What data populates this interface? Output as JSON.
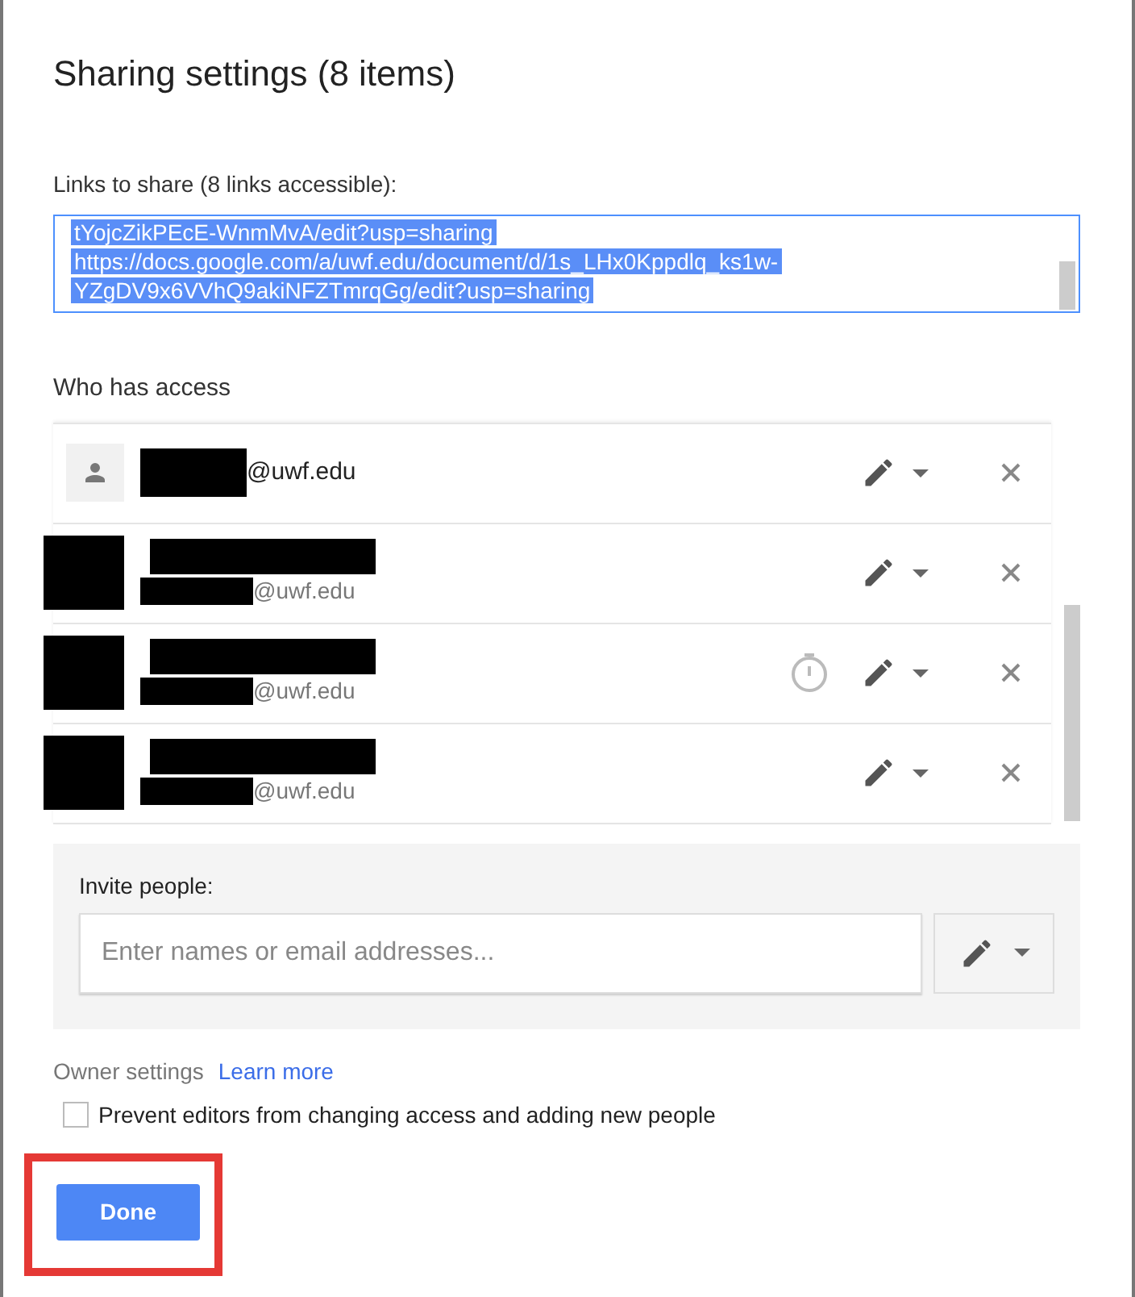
{
  "title": "Sharing settings (8 items)",
  "links": {
    "label": "Links to share (8 links accessible):",
    "lines": [
      "tYojcZikPEcE-WnmMvA/edit?usp=sharing",
      "https://docs.google.com/a/uwf.edu/document/d/1s_LHx0Kppdlq_ks1w-",
      "YZgDV9x6VVhQ9akiNFZTmrqGg/edit?usp=sharing"
    ],
    "selected": true
  },
  "access": {
    "heading": "Who has access",
    "people": [
      {
        "kind": "account",
        "email": "@uwf.edu",
        "expiry": false
      },
      {
        "kind": "redacted",
        "email": "@uwf.edu",
        "expiry": false
      },
      {
        "kind": "redacted",
        "email": "@uwf.edu",
        "expiry": true
      },
      {
        "kind": "redacted",
        "email": "@uwf.edu",
        "expiry": false
      }
    ]
  },
  "invite": {
    "label": "Invite people:",
    "placeholder": "Enter names or email addresses..."
  },
  "owner_settings": {
    "label": "Owner settings",
    "link": "Learn more",
    "option": {
      "label": "Prevent editors from changing access and adding new people",
      "checked": false
    }
  },
  "done": "Done"
}
